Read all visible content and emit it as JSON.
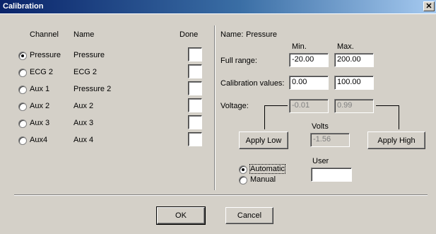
{
  "window": {
    "title": "Calibration",
    "close_glyph": "✕"
  },
  "channels": {
    "header": {
      "channel": "Channel",
      "name": "Name",
      "done": "Done"
    },
    "rows": [
      {
        "channel": "Pressure",
        "name": "Pressure",
        "selected": true
      },
      {
        "channel": "ECG 2",
        "name": "ECG 2",
        "selected": false
      },
      {
        "channel": "Aux 1",
        "name": "Pressure 2",
        "selected": false
      },
      {
        "channel": "Aux 2",
        "name": "Aux 2",
        "selected": false
      },
      {
        "channel": "Aux 3",
        "name": "Aux 3",
        "selected": false
      },
      {
        "channel": "Aux4",
        "name": "Aux 4",
        "selected": false
      }
    ]
  },
  "details": {
    "name_label": "Name:",
    "name_value": "Pressure",
    "min_label": "Min.",
    "max_label": "Max.",
    "full_range_label": "Full range:",
    "full_range_min": "-20.00",
    "full_range_max": "200.00",
    "cal_values_label": "Calibration values:",
    "cal_min": "0.00",
    "cal_max": "100.00",
    "voltage_label": "Voltage:",
    "voltage_low": "-0.01",
    "voltage_high": "0.99",
    "volts_label": "Volts",
    "volts_value": "-1.56",
    "apply_low_label": "Apply Low",
    "apply_high_label": "Apply High",
    "automatic_label": "Automatic",
    "manual_label": "Manual",
    "mode": "automatic",
    "user_label": "User",
    "user_value": ""
  },
  "footer": {
    "ok_label": "OK",
    "cancel_label": "Cancel"
  }
}
